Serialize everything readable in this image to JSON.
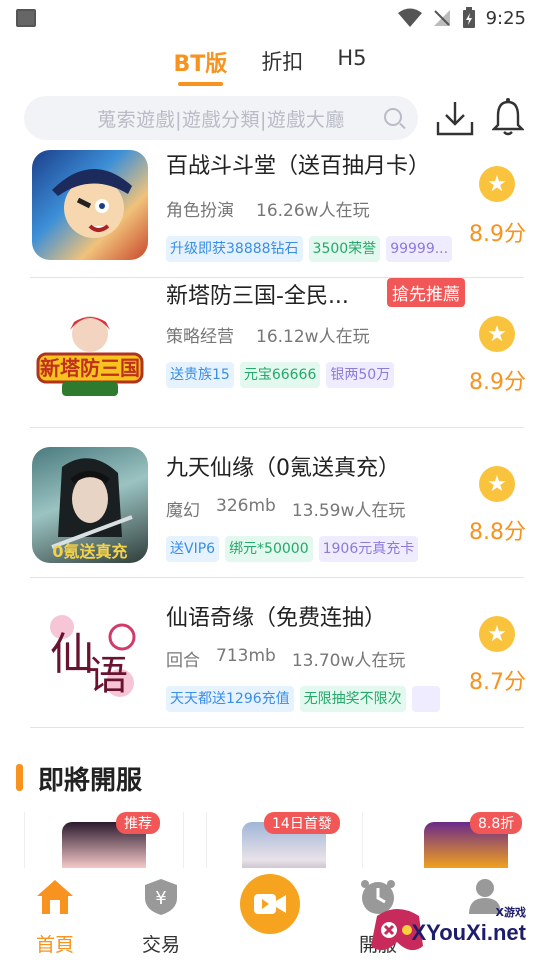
{
  "status": {
    "time": "9:25"
  },
  "tabs": [
    {
      "label": "BT版",
      "active": true
    },
    {
      "label": "折扣",
      "active": false
    },
    {
      "label": "H5",
      "active": false
    }
  ],
  "search": {
    "placeholder": "蒐索遊戲|遊戲分類|遊戲大廳"
  },
  "games": [
    {
      "title": "百战斗斗堂（送百抽月卡）",
      "meta": [
        "角色扮演",
        "16.26w人在玩"
      ],
      "tags": [
        {
          "text": "升级即获38888钻石",
          "color": "blue"
        },
        {
          "text": "3500荣誉",
          "color": "green"
        },
        {
          "text": "99999...",
          "color": "purple"
        }
      ],
      "score": "8.9分",
      "recommend": ""
    },
    {
      "title": "新塔防三国-全民...",
      "meta": [
        "策略经营",
        "16.12w人在玩"
      ],
      "tags": [
        {
          "text": "送贵族15",
          "color": "blue"
        },
        {
          "text": "元宝66666",
          "color": "green"
        },
        {
          "text": "银两50万",
          "color": "purple"
        }
      ],
      "score": "8.9分",
      "recommend": "搶先推薦"
    },
    {
      "title": "九天仙缘（0氪送真充）",
      "meta": [
        "魔幻",
        "326mb",
        "13.59w人在玩"
      ],
      "tags": [
        {
          "text": "送VIP6",
          "color": "blue"
        },
        {
          "text": "绑元*50000",
          "color": "green"
        },
        {
          "text": "1906元真充卡",
          "color": "purple"
        }
      ],
      "score": "8.8分",
      "recommend": ""
    },
    {
      "title": "仙语奇缘（免费连抽）",
      "meta": [
        "回合",
        "713mb",
        "13.70w人在玩"
      ],
      "tags": [
        {
          "text": "天天都送1296充值",
          "color": "blue"
        },
        {
          "text": "无限抽奖不限次",
          "color": "green"
        },
        {
          "text": "",
          "color": "purple"
        }
      ],
      "score": "8.7分",
      "recommend": ""
    }
  ],
  "section": {
    "title": "即將開服"
  },
  "upcoming": [
    {
      "badge": "推荐"
    },
    {
      "badge": "14日首發"
    },
    {
      "badge": "8.8折"
    }
  ],
  "nav": [
    {
      "label": "首頁",
      "active": true
    },
    {
      "label": "交易",
      "active": false
    },
    {
      "label": "",
      "active": false
    },
    {
      "label": "開服",
      "active": false
    },
    {
      "label": "",
      "active": false
    }
  ],
  "watermark": {
    "text": "XYouXi.net",
    "small": "X游戏"
  },
  "colors": {
    "accent": "#f7931e",
    "star": "#f9c33d",
    "recommend": "#f25757"
  }
}
